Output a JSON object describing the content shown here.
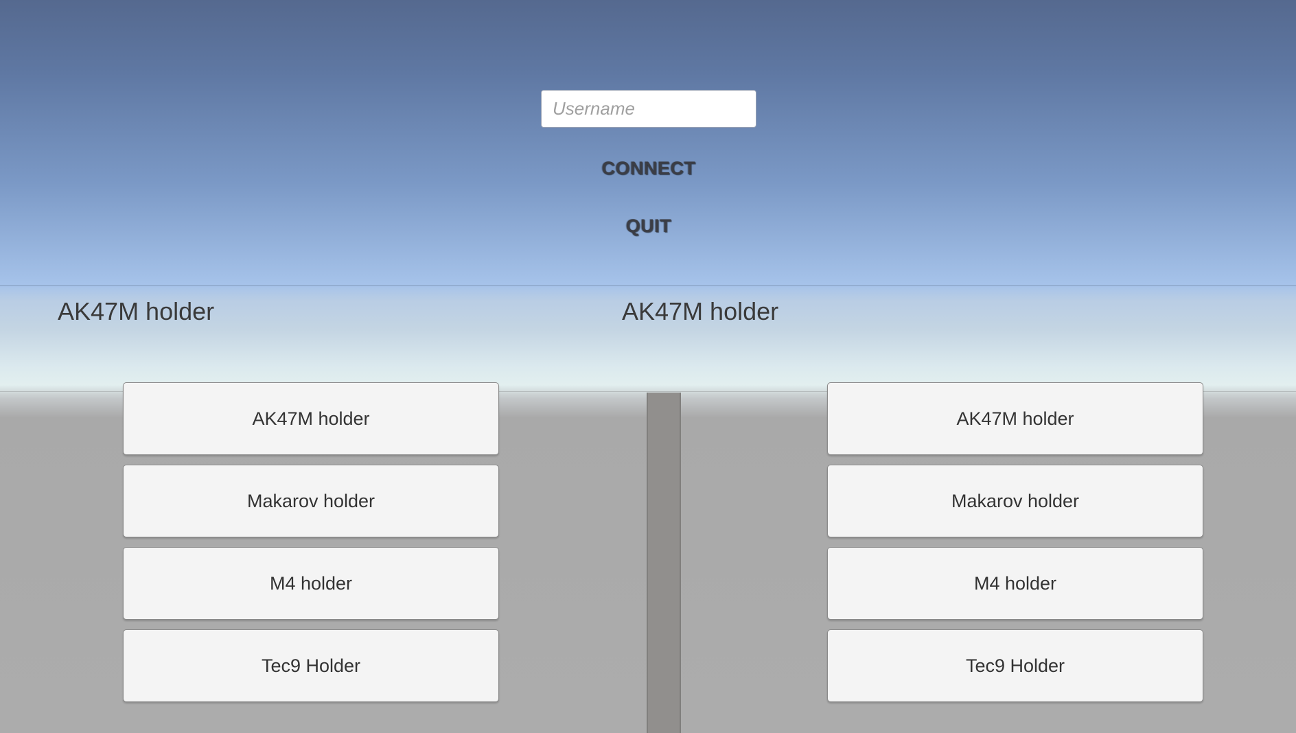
{
  "login": {
    "username_placeholder": "Username",
    "username_value": "",
    "connect_label": "CONNECT",
    "quit_label": "QUIT"
  },
  "left_panel": {
    "title": "AK47M holder",
    "buttons": [
      {
        "label": "AK47M holder"
      },
      {
        "label": "Makarov holder"
      },
      {
        "label": "M4 holder"
      },
      {
        "label": "Tec9 Holder"
      }
    ]
  },
  "right_panel": {
    "title": "AK47M holder",
    "buttons": [
      {
        "label": "AK47M holder"
      },
      {
        "label": "Makarov holder"
      },
      {
        "label": "M4 holder"
      },
      {
        "label": "Tec9 Holder"
      }
    ]
  },
  "colors": {
    "sky_top": "#55698f",
    "sky_horizon": "#a6c3ea",
    "ground": "#acacac",
    "button_face": "#f4f4f4",
    "menu_text": "#3b3d45"
  }
}
